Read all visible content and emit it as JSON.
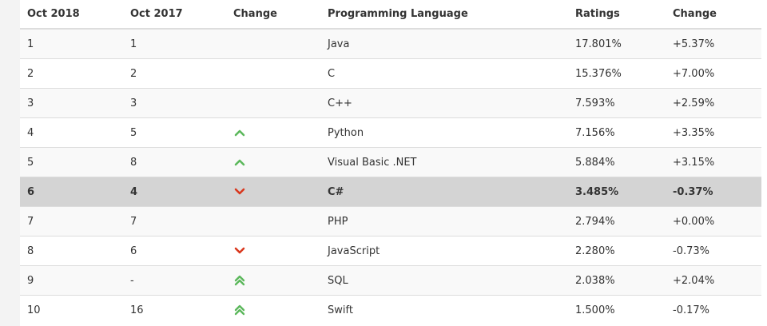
{
  "table": {
    "headers": [
      "Oct 2018",
      "Oct 2017",
      "Change",
      "Programming Language",
      "Ratings",
      "Change"
    ],
    "rows": [
      {
        "rank_2018": "1",
        "rank_2017": "1",
        "trend": "none",
        "language": "Java",
        "rating": "17.801%",
        "change": "+5.37%",
        "highlighted": false
      },
      {
        "rank_2018": "2",
        "rank_2017": "2",
        "trend": "none",
        "language": "C",
        "rating": "15.376%",
        "change": "+7.00%",
        "highlighted": false
      },
      {
        "rank_2018": "3",
        "rank_2017": "3",
        "trend": "none",
        "language": "C++",
        "rating": "7.593%",
        "change": "+2.59%",
        "highlighted": false
      },
      {
        "rank_2018": "4",
        "rank_2017": "5",
        "trend": "up",
        "language": "Python",
        "rating": "7.156%",
        "change": "+3.35%",
        "highlighted": false
      },
      {
        "rank_2018": "5",
        "rank_2017": "8",
        "trend": "up",
        "language": "Visual Basic .NET",
        "rating": "5.884%",
        "change": "+3.15%",
        "highlighted": false
      },
      {
        "rank_2018": "6",
        "rank_2017": "4",
        "trend": "down",
        "language": "C#",
        "rating": "3.485%",
        "change": "-0.37%",
        "highlighted": true
      },
      {
        "rank_2018": "7",
        "rank_2017": "7",
        "trend": "none",
        "language": "PHP",
        "rating": "2.794%",
        "change": "+0.00%",
        "highlighted": false
      },
      {
        "rank_2018": "8",
        "rank_2017": "6",
        "trend": "down",
        "language": "JavaScript",
        "rating": "2.280%",
        "change": "-0.73%",
        "highlighted": false
      },
      {
        "rank_2018": "9",
        "rank_2017": "-",
        "trend": "double-up",
        "language": "SQL",
        "rating": "2.038%",
        "change": "+2.04%",
        "highlighted": false
      },
      {
        "rank_2018": "10",
        "rank_2017": "16",
        "trend": "double-up",
        "language": "Swift",
        "rating": "1.500%",
        "change": "-0.17%",
        "highlighted": false
      }
    ]
  },
  "trend_icons": {
    "up": "chevron-up-icon",
    "double-up": "double-chevron-up-icon",
    "down": "chevron-down-icon"
  },
  "colors": {
    "up": "#5cb85c",
    "down": "#d9381e",
    "highlight_row": "#d4d4d4"
  }
}
